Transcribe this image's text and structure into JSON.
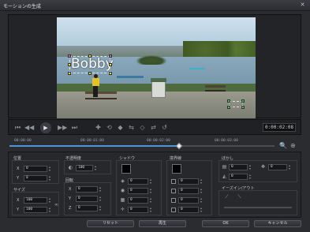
{
  "window": {
    "title": "モーションの生成",
    "close_glyph": "✕"
  },
  "preview": {
    "overlay_text": "Bobby"
  },
  "transport": {
    "buttons": [
      "⏮",
      "◀◀",
      "▶",
      "▶▶",
      "⏭"
    ],
    "keyframe_tools": [
      "✚",
      "⟲",
      "◆",
      "⇆",
      "◇",
      "⇄",
      "↺"
    ],
    "timecode": "0:00:02:08"
  },
  "timeline": {
    "ticks": [
      "00:00:00",
      "00:00:01:00",
      "00:00:02:00",
      "00:00:03:00"
    ],
    "progress": 0.64,
    "zoom_out_glyph": "🔍",
    "zoom_in_glyph": "⊕"
  },
  "props": {
    "position": {
      "label": "位置",
      "x_label": "X",
      "x_value": "0",
      "y_label": "Y",
      "y_value": "0"
    },
    "size": {
      "label": "サイズ",
      "x_label": "X",
      "x_value": "100",
      "y_label": "Y",
      "y_value": "100"
    },
    "opacity": {
      "label": "不透明度",
      "value": "100"
    },
    "rotation": {
      "label": "回転",
      "x_label": "X",
      "x_value": "0",
      "y_label": "Y",
      "y_value": "0",
      "z_label": "Z",
      "z_value": "0"
    },
    "shadow": {
      "label": "シャドウ",
      "rows": [
        "0",
        "0",
        "0",
        "0"
      ]
    },
    "border": {
      "label": "境界線",
      "rows": [
        "0",
        "0",
        "0",
        "0"
      ]
    },
    "blur": {
      "label": "ぼかし",
      "v1": "0",
      "v2": "0",
      "v3": "0"
    },
    "easing": {
      "label": "イーズイン/アウト"
    }
  },
  "footer": {
    "reset": "リセット",
    "preview": "再生",
    "ok": "OK",
    "cancel": "キャンセル"
  },
  "colors": {
    "accent": "#4a96d8",
    "progress": "#4a96d8"
  }
}
